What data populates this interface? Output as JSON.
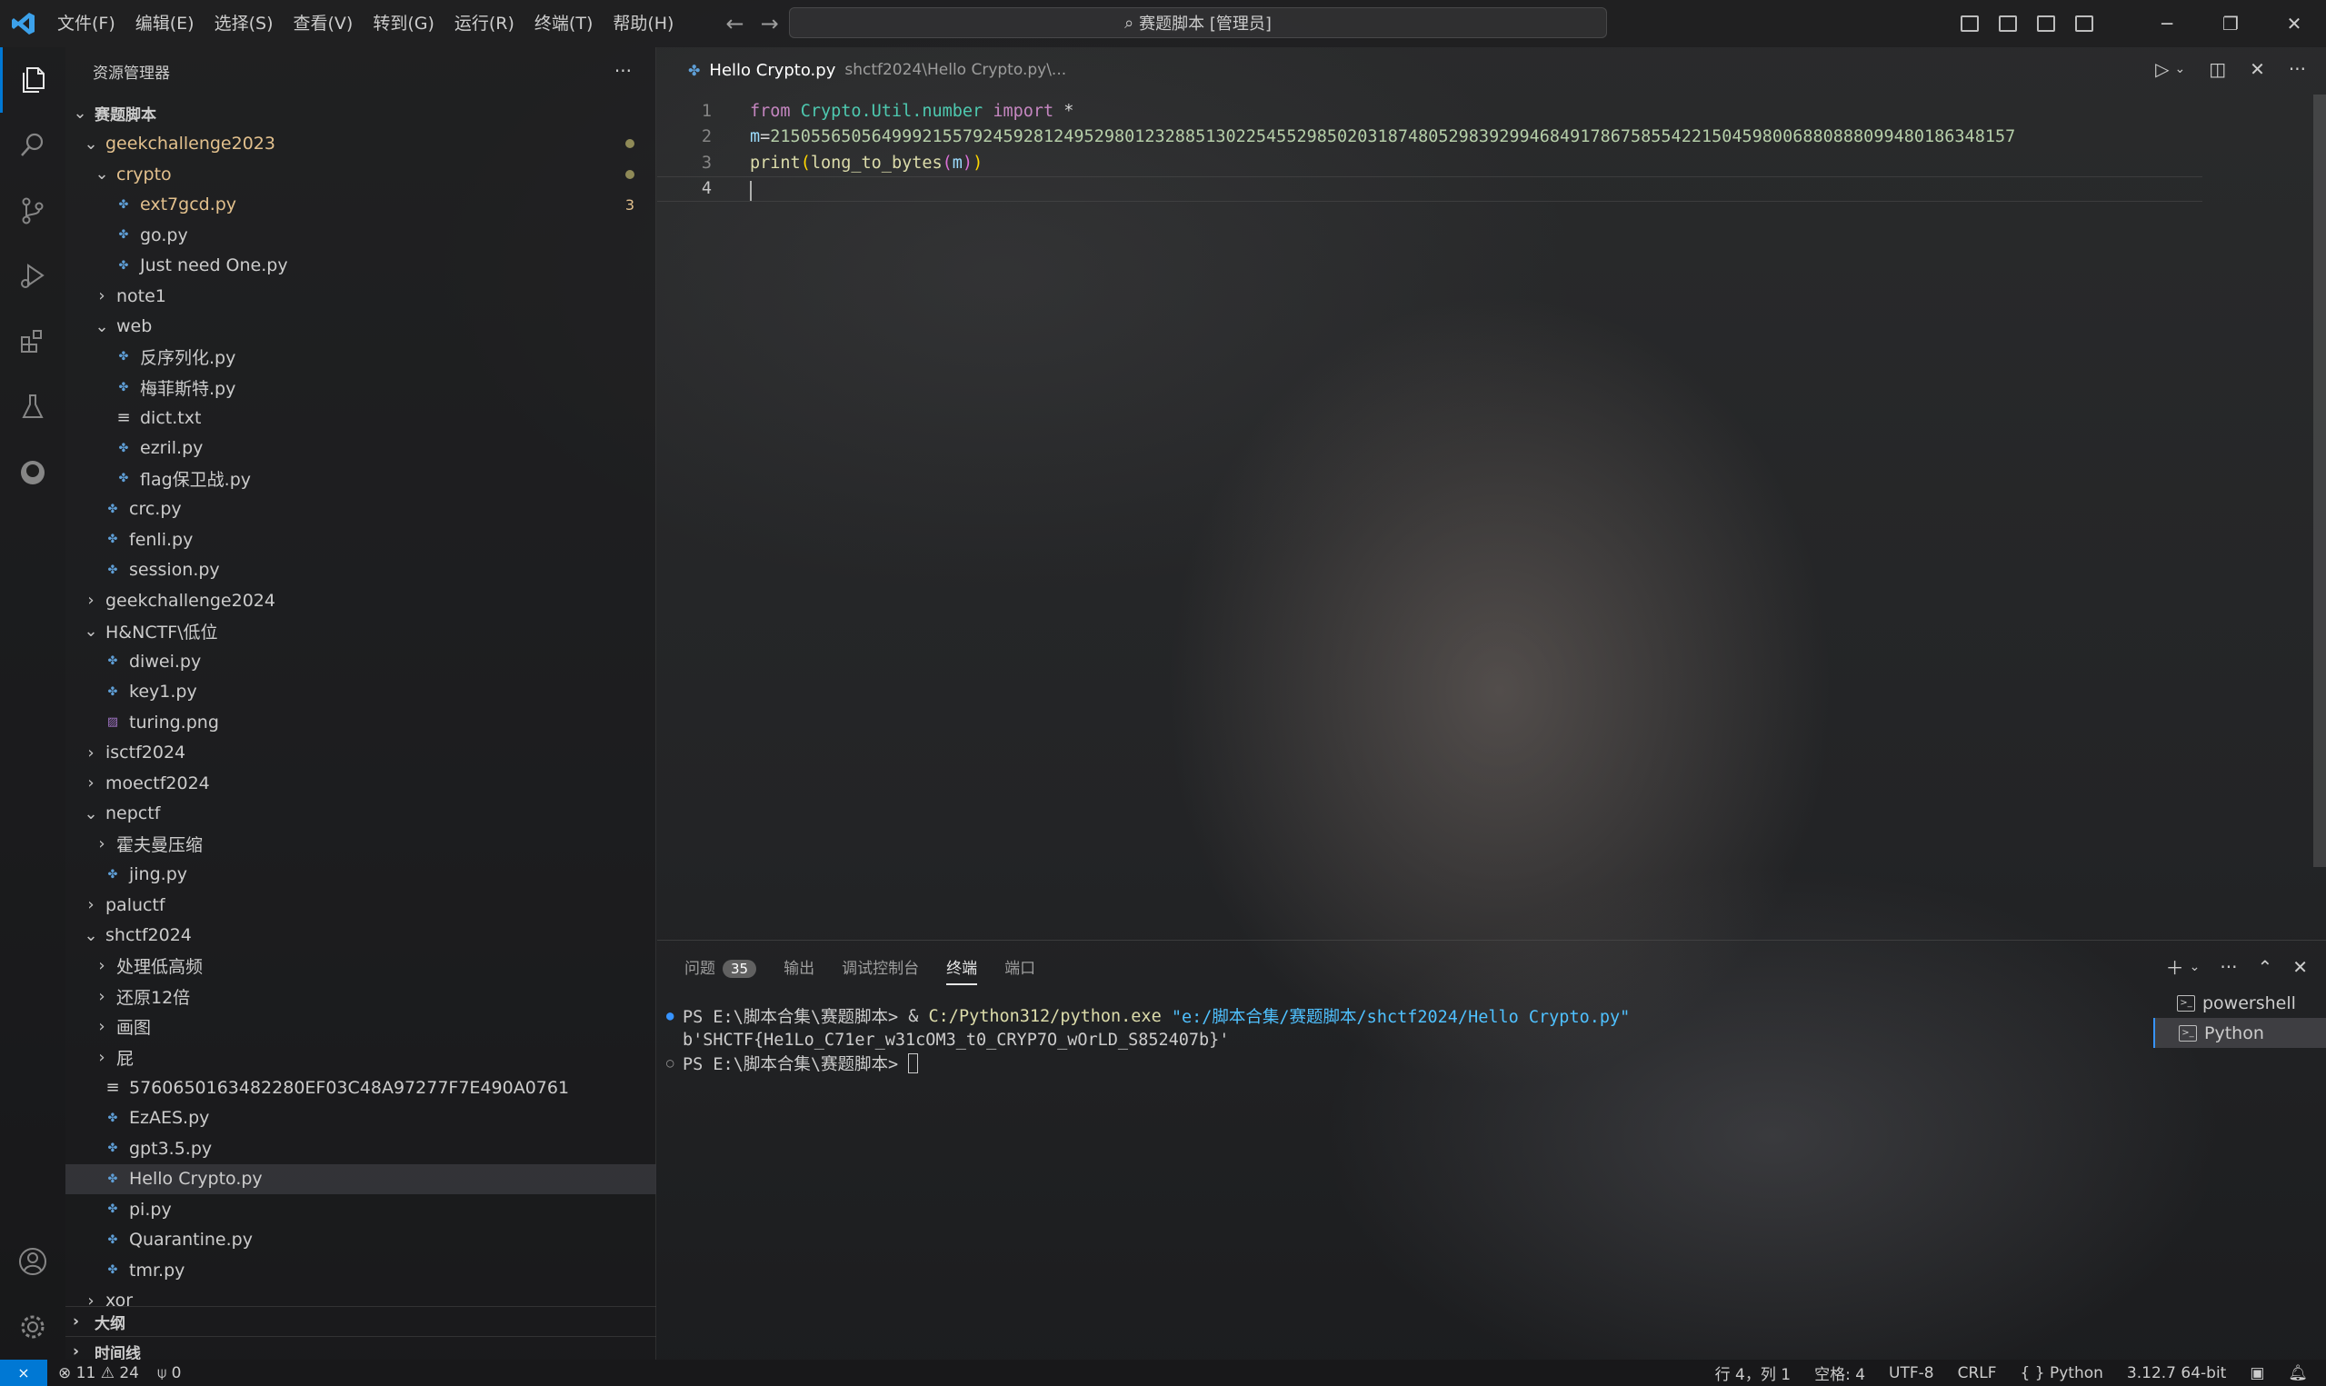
{
  "titlebar": {
    "menus": [
      "文件(F)",
      "编辑(E)",
      "选择(S)",
      "查看(V)",
      "转到(G)",
      "运行(R)",
      "终端(T)",
      "帮助(H)"
    ],
    "command_center": "赛题脚本 [管理员]"
  },
  "sidebar": {
    "title": "资源管理器",
    "more": "···",
    "root": "赛题脚本",
    "tree": [
      {
        "label": "geekchallenge2023",
        "depth": 1,
        "type": "folder-open",
        "modified": true,
        "dot": true
      },
      {
        "label": "crypto",
        "depth": 2,
        "type": "folder-open",
        "modified": true,
        "dot": true
      },
      {
        "label": "ext7gcd.py",
        "depth": 3,
        "type": "py",
        "modified": true,
        "badge": "3"
      },
      {
        "label": "go.py",
        "depth": 3,
        "type": "py"
      },
      {
        "label": "Just need One.py",
        "depth": 3,
        "type": "py"
      },
      {
        "label": "note1",
        "depth": 2,
        "type": "folder"
      },
      {
        "label": "web",
        "depth": 2,
        "type": "folder-open"
      },
      {
        "label": "反序列化.py",
        "depth": 3,
        "type": "py"
      },
      {
        "label": "梅菲斯特.py",
        "depth": 3,
        "type": "py"
      },
      {
        "label": "dict.txt",
        "depth": 3,
        "type": "txt"
      },
      {
        "label": "ezril.py",
        "depth": 3,
        "type": "py"
      },
      {
        "label": "flag保卫战.py",
        "depth": 3,
        "type": "py"
      },
      {
        "label": "crc.py",
        "depth": 2,
        "type": "py"
      },
      {
        "label": "fenli.py",
        "depth": 2,
        "type": "py"
      },
      {
        "label": "session.py",
        "depth": 2,
        "type": "py"
      },
      {
        "label": "geekchallenge2024",
        "depth": 1,
        "type": "folder"
      },
      {
        "label": "H&NCTF\\低位",
        "depth": 1,
        "type": "folder-open"
      },
      {
        "label": "diwei.py",
        "depth": 2,
        "type": "py"
      },
      {
        "label": "key1.py",
        "depth": 2,
        "type": "py"
      },
      {
        "label": "turing.png",
        "depth": 2,
        "type": "png"
      },
      {
        "label": "isctf2024",
        "depth": 1,
        "type": "folder"
      },
      {
        "label": "moectf2024",
        "depth": 1,
        "type": "folder"
      },
      {
        "label": "nepctf",
        "depth": 1,
        "type": "folder-open"
      },
      {
        "label": "霍夫曼压缩",
        "depth": 2,
        "type": "folder"
      },
      {
        "label": "jing.py",
        "depth": 2,
        "type": "py"
      },
      {
        "label": "paluctf",
        "depth": 1,
        "type": "folder"
      },
      {
        "label": "shctf2024",
        "depth": 1,
        "type": "folder-open"
      },
      {
        "label": "处理低高频",
        "depth": 2,
        "type": "folder"
      },
      {
        "label": "还原12倍",
        "depth": 2,
        "type": "folder"
      },
      {
        "label": "画图",
        "depth": 2,
        "type": "folder"
      },
      {
        "label": "屁",
        "depth": 2,
        "type": "folder"
      },
      {
        "label": "5760650163482280EF03C48A97277F7E490A0761",
        "depth": 2,
        "type": "txt"
      },
      {
        "label": "EzAES.py",
        "depth": 2,
        "type": "py"
      },
      {
        "label": "gpt3.5.py",
        "depth": 2,
        "type": "py"
      },
      {
        "label": "Hello Crypto.py",
        "depth": 2,
        "type": "py",
        "selected": true
      },
      {
        "label": "pi.py",
        "depth": 2,
        "type": "py"
      },
      {
        "label": "Quarantine.py",
        "depth": 2,
        "type": "py"
      },
      {
        "label": "tmr.py",
        "depth": 2,
        "type": "py"
      },
      {
        "label": "xor",
        "depth": 1,
        "type": "folder"
      }
    ],
    "outline": "大纲",
    "timeline": "时间线"
  },
  "editor": {
    "tab_name": "Hello Crypto.py",
    "tab_path": "shctf2024\\Hello Crypto.py\\...",
    "lines": [
      {
        "n": "1",
        "parts": [
          [
            "kw",
            "from"
          ],
          [
            "op",
            " "
          ],
          [
            "mod-c",
            "Crypto.Util.number"
          ],
          [
            "op",
            " "
          ],
          [
            "kw",
            "import"
          ],
          [
            "op",
            " *"
          ]
        ]
      },
      {
        "n": "2",
        "parts": [
          [
            "var",
            "m"
          ],
          [
            "op",
            "="
          ],
          [
            "num",
            "215055650564999215579245928124952980123288513022545529850203187480529839299468491786758554221504598006880888099480186348157"
          ]
        ]
      },
      {
        "n": "3",
        "parts": [
          [
            "fn",
            "print"
          ],
          [
            "paren2",
            "("
          ],
          [
            "fn",
            "long_to_bytes"
          ],
          [
            "paren",
            "("
          ],
          [
            "var",
            "m"
          ],
          [
            "paren",
            ")"
          ],
          [
            "paren2",
            ")"
          ]
        ]
      },
      {
        "n": "4",
        "parts": []
      }
    ]
  },
  "panel": {
    "tabs": [
      "问题",
      "输出",
      "调试控制台",
      "终端",
      "端口"
    ],
    "problems_count": "35",
    "terminal_lines": [
      {
        "prompt": "PS E:\\脚本合集\\赛题脚本> ",
        "amp": "& ",
        "exe": "C:/Python312/python.exe",
        "arg": " \"e:/脚本合集/赛题脚本/shctf2024/Hello Crypto.py\""
      },
      {
        "output": "b'SHCTF{He1Lo_C71er_w31cOM3_t0_CRYP7O_wOrLD_S852407b}'"
      },
      {
        "prompt2": "PS E:\\脚本合集\\赛题脚本> "
      }
    ],
    "terminals": [
      "powershell",
      "Python"
    ]
  },
  "statusbar": {
    "errors": "11",
    "warnings": "24",
    "ports": "0",
    "position": "行 4，列 1",
    "spaces": "空格: 4",
    "encoding": "UTF-8",
    "eol": "CRLF",
    "language": "Python",
    "interpreter": "3.12.7 64-bit"
  }
}
